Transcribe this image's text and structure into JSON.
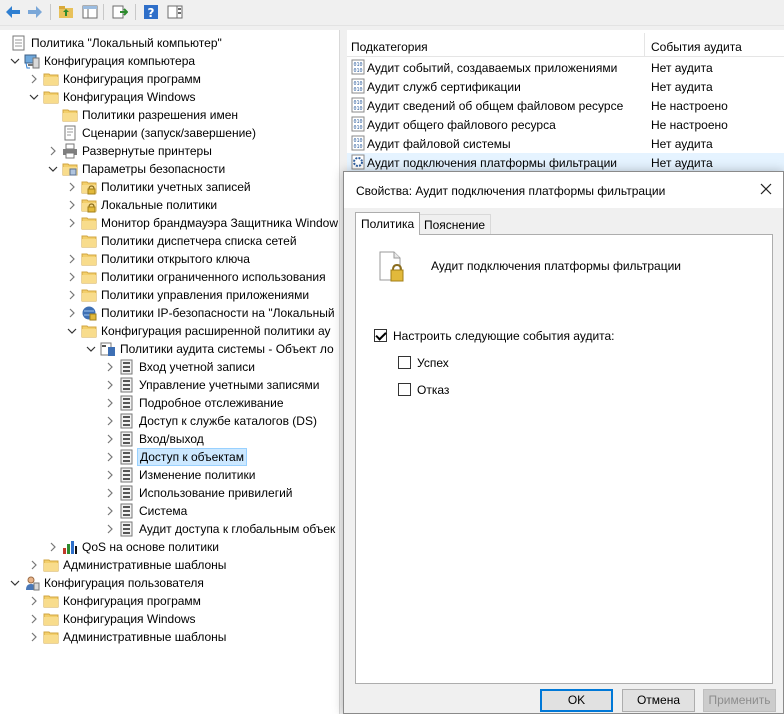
{
  "tree": {
    "root": "Политика \"Локальный компьютер\"",
    "items": [
      {
        "label": "Конфигурация компьютера",
        "level": 1,
        "chev": "down",
        "icon": "computer-icon"
      },
      {
        "label": "Конфигурация программ",
        "level": 2,
        "chev": "right",
        "icon": "folder-icon"
      },
      {
        "label": "Конфигурация Windows",
        "level": 2,
        "chev": "down",
        "icon": "folder-icon"
      },
      {
        "label": "Политики разрешения имен",
        "level": 3,
        "chev": "none",
        "icon": "folder-icon"
      },
      {
        "label": "Сценарии (запуск/завершение)",
        "level": 3,
        "chev": "none",
        "icon": "script-icon"
      },
      {
        "label": "Развернутые принтеры",
        "level": 3,
        "chev": "right",
        "icon": "printer-icon"
      },
      {
        "label": "Параметры безопасности",
        "level": 3,
        "chev": "down",
        "icon": "security-folder-icon"
      },
      {
        "label": "Политики учетных записей",
        "level": 4,
        "chev": "right",
        "icon": "lock-folder-icon"
      },
      {
        "label": "Локальные политики",
        "level": 4,
        "chev": "right",
        "icon": "lock-folder-icon"
      },
      {
        "label": "Монитор брандмауэра Защитника Window",
        "level": 4,
        "chev": "right",
        "icon": "folder-icon"
      },
      {
        "label": "Политики диспетчера списка сетей",
        "level": 4,
        "chev": "none",
        "icon": "folder-icon"
      },
      {
        "label": "Политики открытого ключа",
        "level": 4,
        "chev": "right",
        "icon": "folder-icon"
      },
      {
        "label": "Политики ограниченного использования",
        "level": 4,
        "chev": "right",
        "icon": "folder-icon"
      },
      {
        "label": "Политики управления приложениями",
        "level": 4,
        "chev": "right",
        "icon": "folder-icon"
      },
      {
        "label": "Политики IP-безопасности на \"Локальный",
        "level": 4,
        "chev": "right",
        "icon": "ipsec-icon"
      },
      {
        "label": "Конфигурация расширенной политики ау",
        "level": 4,
        "chev": "down",
        "icon": "folder-icon"
      },
      {
        "label": "Политики аудита системы - Объект ло",
        "level": 5,
        "chev": "down",
        "icon": "audit-root-icon"
      },
      {
        "label": "Вход учетной записи",
        "level": 6,
        "chev": "right",
        "icon": "audit-icon"
      },
      {
        "label": "Управление учетными записями",
        "level": 6,
        "chev": "right",
        "icon": "audit-icon"
      },
      {
        "label": "Подробное отслеживание",
        "level": 6,
        "chev": "right",
        "icon": "audit-icon"
      },
      {
        "label": "Доступ к службе каталогов (DS)",
        "level": 6,
        "chev": "right",
        "icon": "audit-icon"
      },
      {
        "label": "Вход/выход",
        "level": 6,
        "chev": "right",
        "icon": "audit-icon"
      },
      {
        "label": "Доступ к объектам",
        "level": 6,
        "chev": "right",
        "icon": "audit-icon",
        "selected": true
      },
      {
        "label": "Изменение политики",
        "level": 6,
        "chev": "right",
        "icon": "audit-icon"
      },
      {
        "label": "Использование привилегий",
        "level": 6,
        "chev": "right",
        "icon": "audit-icon"
      },
      {
        "label": "Система",
        "level": 6,
        "chev": "right",
        "icon": "audit-icon"
      },
      {
        "label": "Аудит доступа к глобальным объек",
        "level": 6,
        "chev": "right",
        "icon": "audit-icon"
      },
      {
        "label": "QoS на основе политики",
        "level": 3,
        "chev": "right",
        "icon": "chart-icon"
      },
      {
        "label": "Административные шаблоны",
        "level": 2,
        "chev": "right",
        "icon": "folder-icon"
      },
      {
        "label": "Конфигурация пользователя",
        "level": 1,
        "chev": "down",
        "icon": "user-icon"
      },
      {
        "label": "Конфигурация программ",
        "level": 2,
        "chev": "right",
        "icon": "folder-icon"
      },
      {
        "label": "Конфигурация Windows",
        "level": 2,
        "chev": "right",
        "icon": "folder-icon"
      },
      {
        "label": "Административные шаблоны",
        "level": 2,
        "chev": "right",
        "icon": "folder-icon"
      }
    ]
  },
  "list": {
    "col_subcategory": "Подкатегория",
    "col_events": "События аудита",
    "rows": [
      {
        "name": "Аудит событий, создаваемых приложениями",
        "value": "Нет аудита"
      },
      {
        "name": "Аудит служб сертификации",
        "value": "Нет аудита"
      },
      {
        "name": "Аудит сведений об общем файловом ресурсе",
        "value": "Не настроено"
      },
      {
        "name": "Аудит общего файлового ресурса",
        "value": "Не настроено"
      },
      {
        "name": "Аудит файловой системы",
        "value": "Нет аудита"
      },
      {
        "name": "Аудит подключения платформы фильтрации",
        "value": "Нет аудита",
        "highlight": true
      }
    ]
  },
  "dialog": {
    "title": "Свойства: Аудит подключения платформы фильтрации",
    "tab_policy": "Политика",
    "tab_explain": "Пояснение",
    "policy_name": "Аудит подключения платформы фильтрации",
    "configure_label": "Настроить следующие события аудита:",
    "configure_checked": true,
    "success_label": "Успех",
    "success_checked": false,
    "failure_label": "Отказ",
    "failure_checked": false,
    "ok": "OK",
    "cancel": "Отмена",
    "apply": "Применить"
  }
}
